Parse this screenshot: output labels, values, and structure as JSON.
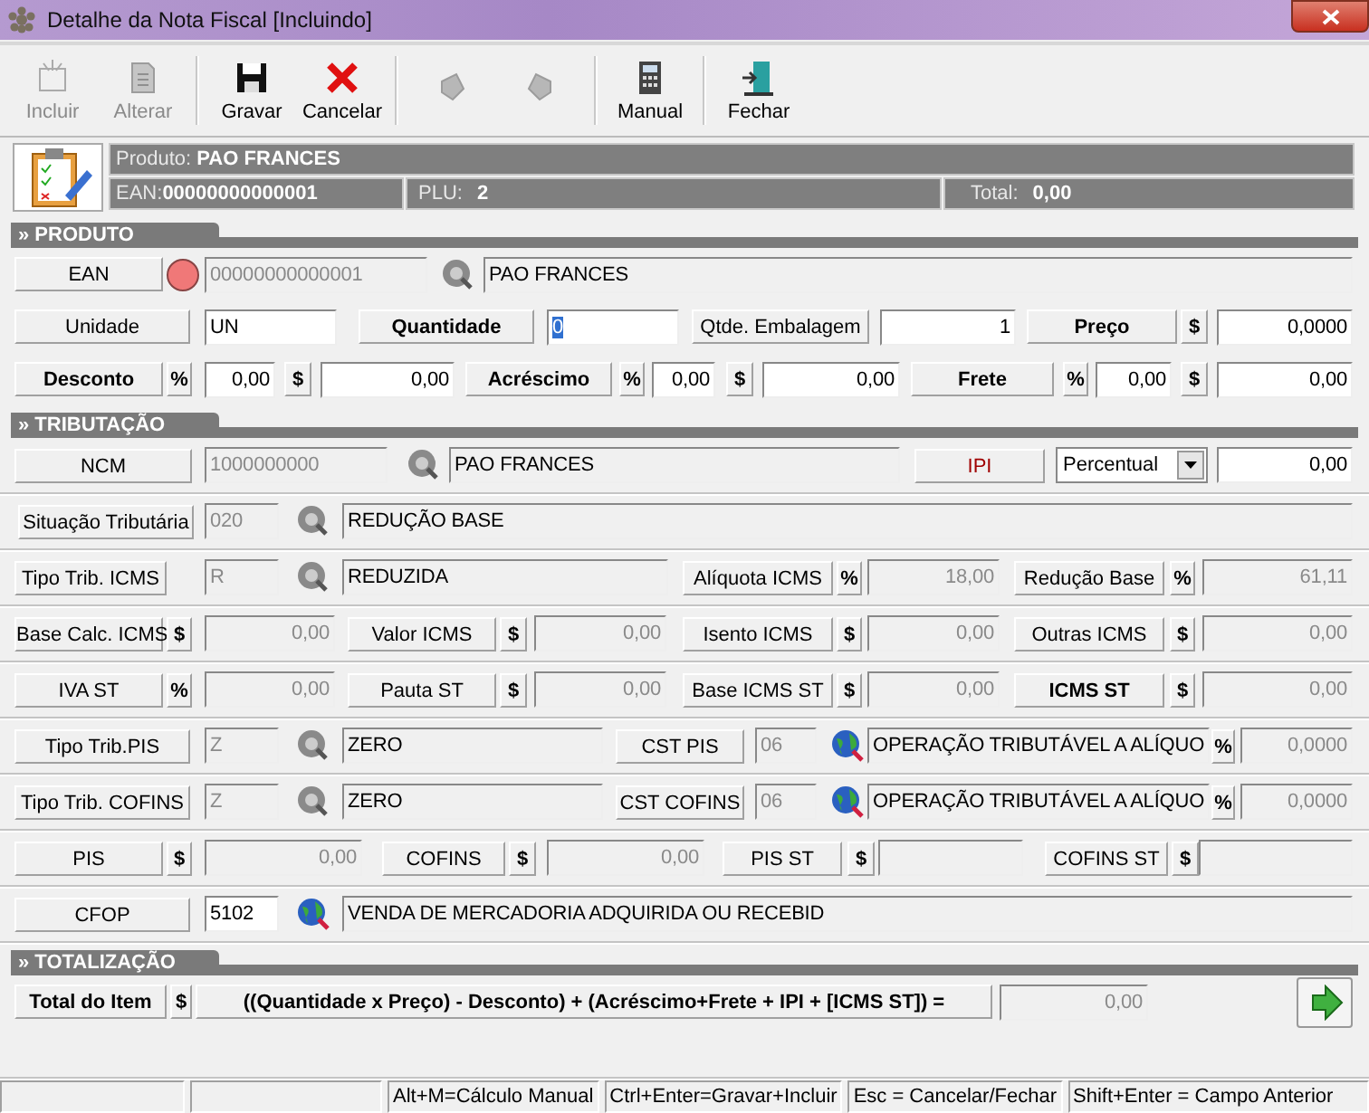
{
  "window": {
    "title": "Detalhe da Nota Fiscal [Incluindo]"
  },
  "toolbar": [
    {
      "kind": "new",
      "label": "Incluir",
      "disabled": true
    },
    {
      "kind": "edit",
      "label": "Alterar",
      "disabled": true
    },
    {
      "kind": "save",
      "label": "Gravar",
      "disabled": false
    },
    {
      "kind": "cancel",
      "label": "Cancelar",
      "disabled": false
    },
    {
      "kind": "prev",
      "disabled": true
    },
    {
      "kind": "next",
      "disabled": true
    },
    {
      "kind": "calc",
      "label": "Manual",
      "disabled": false
    },
    {
      "kind": "exit",
      "label": "Fechar",
      "disabled": false
    }
  ],
  "product_header": {
    "produto_label": "Produto:",
    "produto": "PAO FRANCES",
    "ean_label": "EAN:",
    "ean": "00000000000001",
    "plu_label": "PLU:",
    "plu": "2",
    "total_label": "Total:",
    "total": "0,00"
  },
  "sections": [
    {
      "title": "» PRODUTO",
      "rows": [
        {
          "items": [
            {
              "kind": "label",
              "text": "EAN"
            },
            {
              "kind": "dot",
              "color": "#f07878"
            },
            {
              "kind": "locked",
              "value": "00000000000001"
            },
            {
              "kind": "lookup"
            },
            {
              "kind": "display",
              "value": "PAO FRANCES"
            }
          ]
        },
        {
          "items": [
            {
              "kind": "label",
              "text": "Unidade"
            },
            {
              "kind": "input",
              "value": "UN"
            },
            {
              "kind": "strong",
              "text": "Quantidade"
            },
            {
              "kind": "input",
              "value": "0",
              "focused": true
            },
            {
              "kind": "label",
              "text": "Qtde. Embalagem"
            },
            {
              "kind": "input",
              "value": "1"
            },
            {
              "kind": "strong",
              "text": "Preço"
            },
            {
              "kind": "unit",
              "text": "$"
            },
            {
              "kind": "input",
              "value": "0,0000"
            }
          ]
        },
        {
          "items": [
            {
              "kind": "strong",
              "text": "Desconto"
            },
            {
              "kind": "unit",
              "text": "%"
            },
            {
              "kind": "input",
              "value": "0,00"
            },
            {
              "kind": "unit",
              "text": "$"
            },
            {
              "kind": "input",
              "value": "0,00"
            },
            {
              "kind": "strong",
              "text": "Acréscimo"
            },
            {
              "kind": "unit",
              "text": "%"
            },
            {
              "kind": "input",
              "value": "0,00"
            },
            {
              "kind": "unit",
              "text": "$"
            },
            {
              "kind": "input",
              "value": "0,00"
            },
            {
              "kind": "strong",
              "text": "Frete"
            },
            {
              "kind": "unit",
              "text": "%"
            },
            {
              "kind": "input",
              "value": "0,00"
            },
            {
              "kind": "unit",
              "text": "$"
            },
            {
              "kind": "input",
              "value": "0,00"
            }
          ]
        }
      ]
    },
    {
      "title": "» TRIBUTAÇÃO",
      "rows": [
        {
          "items": [
            {
              "kind": "label",
              "text": "NCM"
            },
            {
              "kind": "locked",
              "value": "1000000000"
            },
            {
              "kind": "lookup"
            },
            {
              "kind": "display",
              "value": "PAO FRANCES"
            },
            {
              "kind": "alert",
              "text": "IPI"
            },
            {
              "kind": "select",
              "value": "Percentual"
            },
            {
              "kind": "input",
              "value": "0,00"
            }
          ]
        },
        {
          "items": [
            {
              "kind": "label",
              "text": "Situação Tributária"
            },
            {
              "kind": "locked",
              "value": "020"
            },
            {
              "kind": "lookup"
            },
            {
              "kind": "display",
              "value": "REDUÇÃO BASE"
            }
          ]
        },
        {
          "items": [
            {
              "kind": "label",
              "text": "Tipo Trib. ICMS"
            },
            {
              "kind": "locked",
              "value": "R"
            },
            {
              "kind": "lookup"
            },
            {
              "kind": "display",
              "value": "REDUZIDA"
            },
            {
              "kind": "label",
              "text": "Alíquota ICMS"
            },
            {
              "kind": "unit",
              "text": "%"
            },
            {
              "kind": "locked",
              "value": "18,00"
            },
            {
              "kind": "label",
              "text": "Redução Base"
            },
            {
              "kind": "unit",
              "text": "%"
            },
            {
              "kind": "locked",
              "value": "61,11"
            }
          ]
        },
        {
          "items": [
            {
              "kind": "label",
              "text": "Base Calc. ICMS"
            },
            {
              "kind": "unit",
              "text": "$"
            },
            {
              "kind": "locked",
              "value": "0,00"
            },
            {
              "kind": "label",
              "text": "Valor ICMS"
            },
            {
              "kind": "unit",
              "text": "$"
            },
            {
              "kind": "locked",
              "value": "0,00"
            },
            {
              "kind": "label",
              "text": "Isento ICMS"
            },
            {
              "kind": "unit",
              "text": "$"
            },
            {
              "kind": "locked",
              "value": "0,00"
            },
            {
              "kind": "label",
              "text": "Outras ICMS"
            },
            {
              "kind": "unit",
              "text": "$"
            },
            {
              "kind": "locked",
              "value": "0,00"
            }
          ]
        },
        {
          "items": [
            {
              "kind": "label",
              "text": "IVA ST"
            },
            {
              "kind": "unit",
              "text": "%"
            },
            {
              "kind": "locked",
              "value": "0,00"
            },
            {
              "kind": "label",
              "text": "Pauta ST"
            },
            {
              "kind": "unit",
              "text": "$"
            },
            {
              "kind": "locked",
              "value": "0,00"
            },
            {
              "kind": "label",
              "text": "Base ICMS ST"
            },
            {
              "kind": "unit",
              "text": "$"
            },
            {
              "kind": "locked",
              "value": "0,00"
            },
            {
              "kind": "strong",
              "text": "ICMS ST"
            },
            {
              "kind": "unit",
              "text": "$"
            },
            {
              "kind": "locked",
              "value": "0,00"
            }
          ]
        },
        {
          "items": [
            {
              "kind": "label",
              "text": "Tipo Trib.PIS"
            },
            {
              "kind": "locked",
              "value": "Z"
            },
            {
              "kind": "lookup"
            },
            {
              "kind": "display",
              "value": "ZERO"
            },
            {
              "kind": "label",
              "text": "CST PIS"
            },
            {
              "kind": "locked",
              "value": "06"
            },
            {
              "kind": "globe"
            },
            {
              "kind": "display",
              "value": "OPERAÇÃO TRIBUTÁVEL A ALÍQUO"
            },
            {
              "kind": "unit",
              "text": "%"
            },
            {
              "kind": "locked",
              "value": "0,0000"
            }
          ]
        },
        {
          "items": [
            {
              "kind": "label",
              "text": "Tipo Trib. COFINS"
            },
            {
              "kind": "locked",
              "value": "Z"
            },
            {
              "kind": "lookup"
            },
            {
              "kind": "display",
              "value": "ZERO"
            },
            {
              "kind": "label",
              "text": "CST COFINS"
            },
            {
              "kind": "locked",
              "value": "06"
            },
            {
              "kind": "globe"
            },
            {
              "kind": "display",
              "value": "OPERAÇÃO TRIBUTÁVEL A ALÍQUO"
            },
            {
              "kind": "unit",
              "text": "%"
            },
            {
              "kind": "locked",
              "value": "0,0000"
            }
          ]
        },
        {
          "items": [
            {
              "kind": "label",
              "text": "PIS"
            },
            {
              "kind": "unit",
              "text": "$"
            },
            {
              "kind": "locked",
              "value": "0,00"
            },
            {
              "kind": "label",
              "text": "COFINS"
            },
            {
              "kind": "unit",
              "text": "$"
            },
            {
              "kind": "locked",
              "value": "0,00"
            },
            {
              "kind": "label",
              "text": "PIS ST"
            },
            {
              "kind": "unit",
              "text": "$"
            },
            {
              "kind": "locked"
            },
            {
              "kind": "label",
              "text": "COFINS ST"
            },
            {
              "kind": "unit",
              "text": "$"
            },
            {
              "kind": "locked"
            }
          ]
        },
        {
          "items": [
            {
              "kind": "label",
              "text": "CFOP"
            },
            {
              "kind": "input",
              "value": "5102"
            },
            {
              "kind": "globe"
            },
            {
              "kind": "display",
              "value": "VENDA DE MERCADORIA ADQUIRIDA OU RECEBID"
            }
          ]
        }
      ]
    },
    {
      "title": "» TOTALIZAÇÃO",
      "rows": [
        {
          "items": [
            {
              "kind": "strong",
              "text": "Total do Item"
            },
            {
              "kind": "unit",
              "text": "$"
            },
            {
              "kind": "strong",
              "text": "((Quantidade x Preço) - Desconto) + (Acréscimo+Frete + IPI + [ICMS ST]) ="
            },
            {
              "kind": "locked",
              "value": "0,00"
            },
            {
              "kind": "button"
            }
          ]
        }
      ]
    }
  ],
  "status_bar": [
    "Alt+M=Cálculo Manual",
    "Ctrl+Enter=Gravar+Incluir",
    "Esc = Cancelar/Fechar",
    "Shift+Enter = Campo Anterior"
  ]
}
